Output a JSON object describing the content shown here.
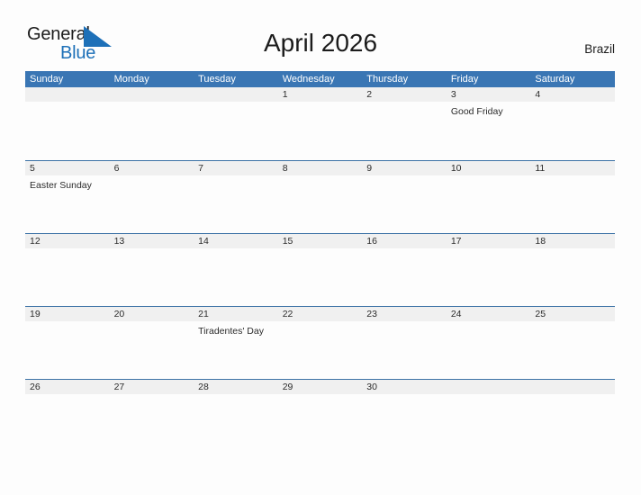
{
  "logo": {
    "word_one": "General",
    "word_two": "Blue",
    "flag_icon": "blue-triangle-flag-icon",
    "color_dark": "#1c1c1c",
    "color_blue": "#1d70b8"
  },
  "header": {
    "title": "April 2026",
    "region": "Brazil"
  },
  "colors": {
    "header_bar": "#3a76b4",
    "date_band": "#f0f0f0",
    "row_rule": "#3c72a6",
    "page_background": "#fdfdfd",
    "text": "#2b2b2b"
  },
  "weekdays": [
    "Sunday",
    "Monday",
    "Tuesday",
    "Wednesday",
    "Thursday",
    "Friday",
    "Saturday"
  ],
  "weeks": [
    {
      "days": [
        {
          "date": "",
          "event": ""
        },
        {
          "date": "",
          "event": ""
        },
        {
          "date": "",
          "event": ""
        },
        {
          "date": "1",
          "event": ""
        },
        {
          "date": "2",
          "event": ""
        },
        {
          "date": "3",
          "event": "Good Friday"
        },
        {
          "date": "4",
          "event": ""
        }
      ]
    },
    {
      "days": [
        {
          "date": "5",
          "event": "Easter Sunday"
        },
        {
          "date": "6",
          "event": ""
        },
        {
          "date": "7",
          "event": ""
        },
        {
          "date": "8",
          "event": ""
        },
        {
          "date": "9",
          "event": ""
        },
        {
          "date": "10",
          "event": ""
        },
        {
          "date": "11",
          "event": ""
        }
      ]
    },
    {
      "days": [
        {
          "date": "12",
          "event": ""
        },
        {
          "date": "13",
          "event": ""
        },
        {
          "date": "14",
          "event": ""
        },
        {
          "date": "15",
          "event": ""
        },
        {
          "date": "16",
          "event": ""
        },
        {
          "date": "17",
          "event": ""
        },
        {
          "date": "18",
          "event": ""
        }
      ]
    },
    {
      "days": [
        {
          "date": "19",
          "event": ""
        },
        {
          "date": "20",
          "event": ""
        },
        {
          "date": "21",
          "event": "Tiradentes' Day"
        },
        {
          "date": "22",
          "event": ""
        },
        {
          "date": "23",
          "event": ""
        },
        {
          "date": "24",
          "event": ""
        },
        {
          "date": "25",
          "event": ""
        }
      ]
    },
    {
      "days": [
        {
          "date": "26",
          "event": ""
        },
        {
          "date": "27",
          "event": ""
        },
        {
          "date": "28",
          "event": ""
        },
        {
          "date": "29",
          "event": ""
        },
        {
          "date": "30",
          "event": ""
        },
        {
          "date": "",
          "event": ""
        },
        {
          "date": "",
          "event": ""
        }
      ]
    }
  ]
}
